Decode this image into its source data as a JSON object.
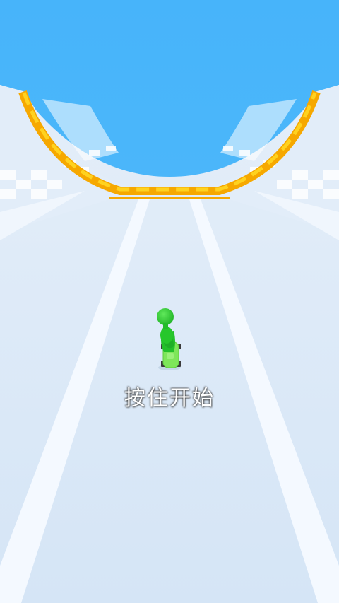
{
  "game": {
    "start_hint": "按住开始"
  },
  "colors": {
    "sky": "#4db8fb",
    "track": "#dbe9f8",
    "track_stripe": "#f3f8fe",
    "ramp_orange": "#f6a800",
    "ramp_yellow": "#ffd21f",
    "player_green": "#26c72b",
    "skateboard_green": "#7ee65a"
  },
  "icons": {
    "player": "stickman-figure-icon",
    "board": "skateboard-icon"
  }
}
